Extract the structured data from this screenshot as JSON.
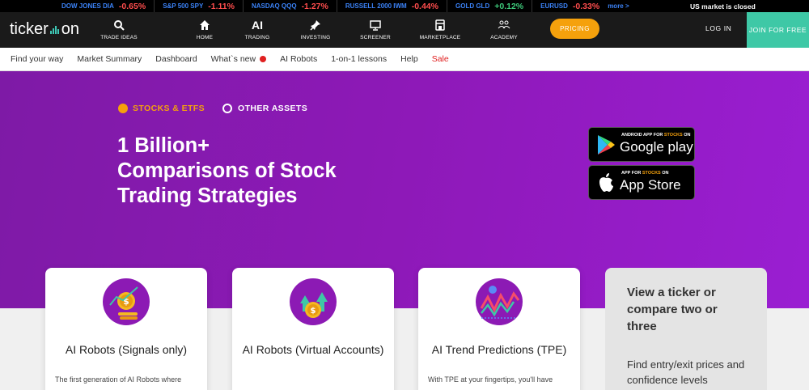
{
  "ticker": {
    "items": [
      {
        "symbol": "DOW JONES DIA",
        "change": "-0.65%",
        "color": "#ff4d4d"
      },
      {
        "symbol": "S&P 500 SPY",
        "change": "-1.11%",
        "color": "#ff4d4d"
      },
      {
        "symbol": "NASDAQ QQQ",
        "change": "-1.27%",
        "color": "#ff4d4d"
      },
      {
        "symbol": "RUSSELL 2000 IWM",
        "change": "-0.44%",
        "color": "#ff4d4d"
      },
      {
        "symbol": "GOLD GLD",
        "change": "+0.12%",
        "color": "#3ec87a"
      },
      {
        "symbol": "EURUSD",
        "change": "-0.33%",
        "color": "#ff4d4d"
      }
    ],
    "more_label": "more >",
    "market_status": "US market is closed"
  },
  "nav": {
    "logo_left": "ticker",
    "logo_right": "on",
    "items": [
      {
        "label": "TRADE IDEAS",
        "icon": "lightbulb-search-icon"
      },
      {
        "label": "HOME",
        "icon": "home-icon"
      },
      {
        "label": "TRADING",
        "icon": "ai-icon",
        "icon_text": "AI"
      },
      {
        "label": "INVESTING",
        "icon": "pin-icon"
      },
      {
        "label": "SCREENER",
        "icon": "monitor-icon"
      },
      {
        "label": "MARKETPLACE",
        "icon": "store-icon"
      },
      {
        "label": "ACADEMY",
        "icon": "people-icon"
      }
    ],
    "pricing_label": "PRICING",
    "login_label": "LOG IN",
    "join_label": "JOIN FOR FREE"
  },
  "subnav": {
    "items": [
      "Find your way",
      "Market Summary",
      "Dashboard",
      "What`s new",
      "AI Robots",
      "1-on-1 lessons",
      "Help",
      "Sale"
    ]
  },
  "hero": {
    "radio_on_label": "STOCKS & ETFS",
    "radio_off_label": "OTHER ASSETS",
    "headline_1": "1 Billion+",
    "headline_2": "Comparisons of Stock",
    "headline_3": "Trading Strategies",
    "google": {
      "small_pre": "ANDROID APP FOR ",
      "small_hl": "STOCKS",
      "small_post": " ON",
      "big": "Google play"
    },
    "apple": {
      "small_pre": "APP FOR ",
      "small_hl": "STOCKS",
      "small_post": " ON",
      "big": "App Store"
    }
  },
  "cards": [
    {
      "title": "AI Robots (Signals only)",
      "desc": "The first generation of AI Robots where",
      "icon": "robot-signals-icon"
    },
    {
      "title": "AI Robots (Virtual Accounts)",
      "desc": "",
      "icon": "robot-virtual-icon"
    },
    {
      "title": "AI Trend Predictions (TPE)",
      "desc": "With TPE at your fingertips, you'll have",
      "icon": "trend-prediction-icon"
    }
  ],
  "side_card": {
    "title": "View a ticker or compare two or three",
    "desc": "Find entry/exit prices and confidence levels"
  },
  "colors": {
    "accent": "#f5a10c",
    "teal": "#3ec8a6",
    "hero_purple": "#8e19b8"
  }
}
